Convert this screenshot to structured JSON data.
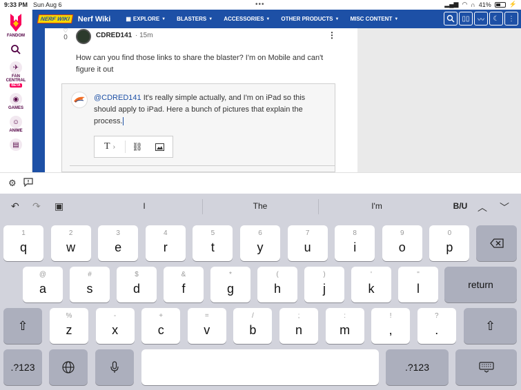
{
  "status": {
    "time": "9:33 PM",
    "date": "Sun Aug 6",
    "battery": "41%",
    "more": "•••"
  },
  "fandom_rail": {
    "items": [
      {
        "label": "FANDOM"
      },
      {
        "label": "FAN CENTRAL",
        "badge": "BETA"
      },
      {
        "label": "GAMES"
      },
      {
        "label": "ANIME"
      }
    ]
  },
  "navbar": {
    "logo_text": "NERF WIKI",
    "wiki_name": "Nerf Wiki",
    "items": [
      "EXPLORE",
      "BLASTERS",
      "ACCESSORIES",
      "OTHER PRODUCTS",
      "MISC CONTENT"
    ]
  },
  "comment": {
    "vote_count": "0",
    "author": "CDRED141",
    "separator": "·",
    "time_ago": "15m",
    "text": "How can you find those links to share the blaster? I'm on Mobile and can't figure it out"
  },
  "reply": {
    "mention": "@CDRED141",
    "text": " It's really simple actually, and I'm on iPad so this should apply to iPad. Here a bunch of pictures that explain the process."
  },
  "keyboard": {
    "suggestions": [
      "I",
      "The",
      "I'm"
    ],
    "format_label": "B/U",
    "row1": [
      {
        "hint": "1",
        "key": "q"
      },
      {
        "hint": "2",
        "key": "w"
      },
      {
        "hint": "3",
        "key": "e"
      },
      {
        "hint": "4",
        "key": "r"
      },
      {
        "hint": "5",
        "key": "t"
      },
      {
        "hint": "6",
        "key": "y"
      },
      {
        "hint": "7",
        "key": "u"
      },
      {
        "hint": "8",
        "key": "i"
      },
      {
        "hint": "9",
        "key": "o"
      },
      {
        "hint": "0",
        "key": "p"
      }
    ],
    "row2": [
      {
        "hint": "@",
        "key": "a"
      },
      {
        "hint": "#",
        "key": "s"
      },
      {
        "hint": "$",
        "key": "d"
      },
      {
        "hint": "&",
        "key": "f"
      },
      {
        "hint": "*",
        "key": "g"
      },
      {
        "hint": "(",
        "key": "h"
      },
      {
        "hint": ")",
        "key": "j"
      },
      {
        "hint": "'",
        "key": "k"
      },
      {
        "hint": "\"",
        "key": "l"
      }
    ],
    "row3": [
      {
        "hint": "%",
        "key": "z"
      },
      {
        "hint": "-",
        "key": "x"
      },
      {
        "hint": "+",
        "key": "c"
      },
      {
        "hint": "=",
        "key": "v"
      },
      {
        "hint": "/",
        "key": "b"
      },
      {
        "hint": ";",
        "key": "n"
      },
      {
        "hint": ":",
        "key": "m"
      },
      {
        "hint": "!",
        "key": ","
      },
      {
        "hint": "?",
        "key": "."
      }
    ],
    "return_label": "return",
    "numbers_label": ".?123"
  }
}
